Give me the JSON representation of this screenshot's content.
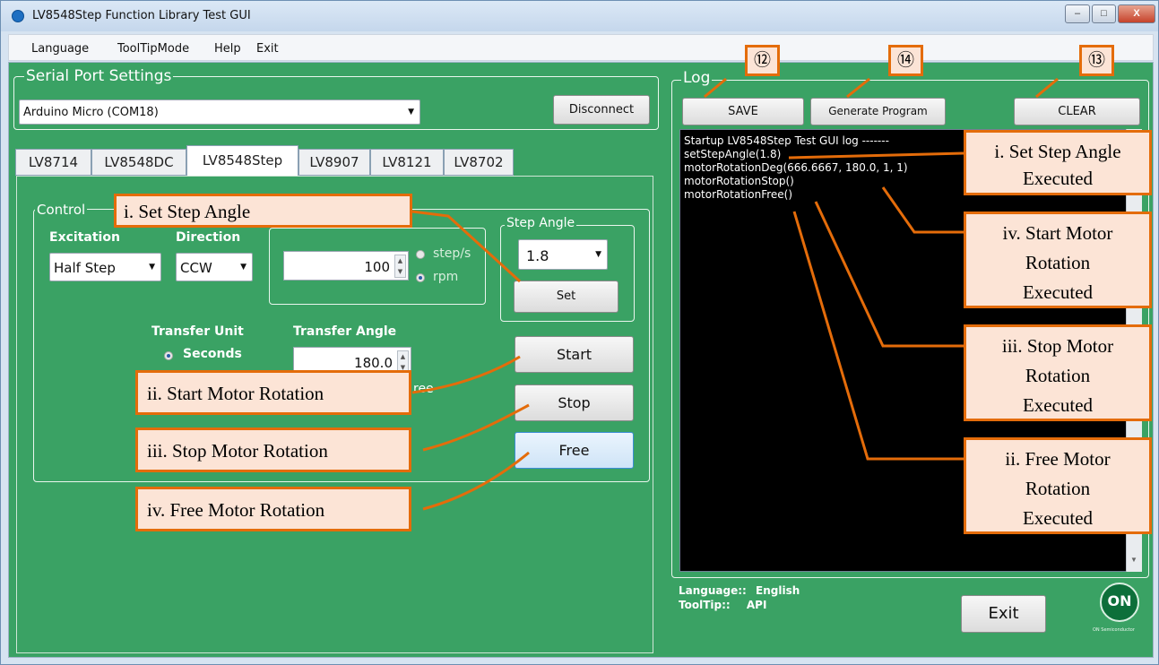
{
  "window": {
    "title": "LV8548Step Function Library Test GUI",
    "min_label": "–",
    "max_label": "□",
    "close_label": "X"
  },
  "menu": {
    "items": [
      "Language",
      "ToolTipMode",
      "Help",
      "Exit"
    ]
  },
  "serial": {
    "legend": "Serial Port Settings",
    "port": "Arduino Micro (COM18)",
    "disconnect": "Disconnect"
  },
  "tabs": [
    "LV8714",
    "LV8548DC",
    "LV8548Step",
    "LV8907",
    "LV8121",
    "LV8702"
  ],
  "control": {
    "legend": "Control",
    "excitation_label": "Excitation",
    "excitation_value": "Half Step",
    "direction_label": "Direction",
    "direction_value": "CCW",
    "speed_value": "100",
    "unit_steps": "step/s",
    "unit_rpm": "rpm",
    "step_angle_legend": "Step Angle",
    "step_angle_value": "1.8",
    "set_button": "Set",
    "transfer_unit_label": "Transfer Unit",
    "transfer_unit_seconds": "Seconds",
    "transfer_angle_label": "Transfer Angle",
    "transfer_angle_value": "180.0",
    "degree_fragment": "ree",
    "start_button": "Start",
    "stop_button": "Stop",
    "free_button": "Free"
  },
  "log": {
    "legend": "Log",
    "save": "SAVE",
    "generate": "Generate Program",
    "clear": "CLEAR",
    "lines": [
      "Startup LV8548Step Test GUI log -------",
      "setStepAngle(1.8)",
      "motorRotationDeg(666.6667, 180.0, 1, 1)",
      "motorRotationStop()",
      "motorRotationFree()"
    ]
  },
  "status": {
    "language_label": "Language::",
    "language_value": "English",
    "tooltip_label": "ToolTip::",
    "tooltip_value": "API"
  },
  "exit_button": "Exit",
  "logo": {
    "text": "ON",
    "caption": "ON Semiconductor"
  },
  "annotations": {
    "num12": "⑫",
    "num14": "⑭",
    "num13": "⑬",
    "left": [
      "i.  Set Step Angle",
      "ii.  Start Motor Rotation",
      "iii.  Stop Motor Rotation",
      "iv.  Free Motor Rotation"
    ],
    "right": [
      [
        "i.  Set Step  Angle",
        "Executed"
      ],
      [
        "iv.  Start Motor",
        "Rotation",
        "Executed"
      ],
      [
        "iii.  Stop Motor",
        "Rotation",
        "Executed"
      ],
      [
        "ii.  Free Motor",
        "Rotation",
        "Executed"
      ]
    ]
  },
  "colors": {
    "panel_green": "#3aa264",
    "callout_border": "#e46c0a",
    "callout_fill": "#fce4d6"
  }
}
